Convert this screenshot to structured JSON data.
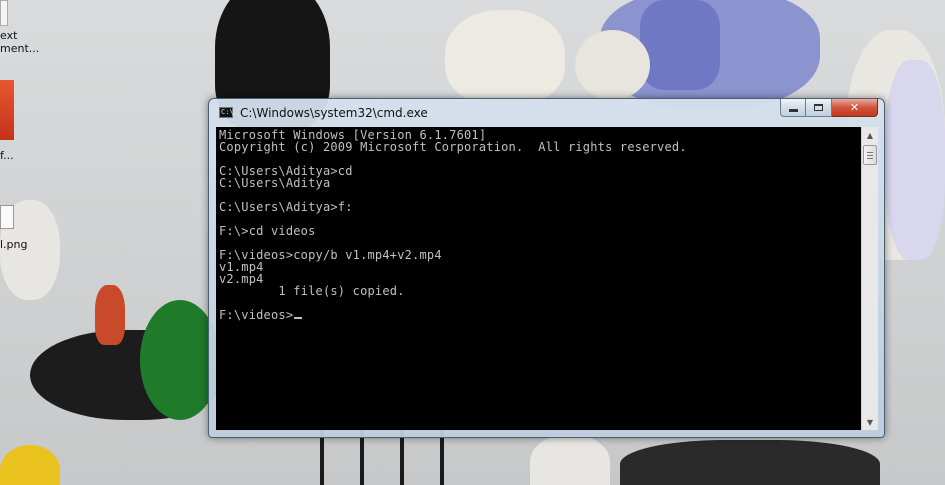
{
  "desktop": {
    "icon_labels": [
      "ext\nment...",
      "f...",
      "l.png"
    ]
  },
  "window": {
    "title": "C:\\Windows\\system32\\cmd.exe",
    "icon_text": "C:\\",
    "buttons": {
      "minimize_icon": "minimize-icon",
      "maximize_icon": "maximize-icon",
      "close_label": "✕"
    }
  },
  "console": {
    "lines": [
      "Microsoft Windows [Version 6.1.7601]",
      "Copyright (c) 2009 Microsoft Corporation.  All rights reserved.",
      "",
      "C:\\Users\\Aditya>cd",
      "C:\\Users\\Aditya",
      "",
      "C:\\Users\\Aditya>f:",
      "",
      "F:\\>cd videos",
      "",
      "F:\\videos>copy/b v1.mp4+v2.mp4",
      "v1.mp4",
      "v2.mp4",
      "        1 file(s) copied.",
      "",
      "F:\\videos>"
    ],
    "text_color": "#c0c0c0",
    "background": "#000000"
  },
  "scrollbar": {
    "up_arrow": "▲",
    "down_arrow": "▼"
  }
}
